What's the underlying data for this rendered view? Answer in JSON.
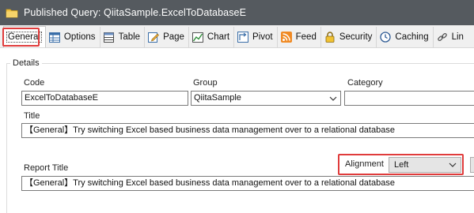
{
  "window": {
    "title": "Published Query: QiitaSample.ExcelToDatabaseE",
    "icon": "folder-icon"
  },
  "tabs": [
    {
      "label": "General",
      "icon": "none",
      "active": true
    },
    {
      "label": "Options",
      "icon": "options-grid-icon"
    },
    {
      "label": "Table",
      "icon": "table-icon"
    },
    {
      "label": "Page",
      "icon": "page-edit-icon"
    },
    {
      "label": "Chart",
      "icon": "chart-icon"
    },
    {
      "label": "Pivot",
      "icon": "pivot-icon"
    },
    {
      "label": "Feed",
      "icon": "rss-feed-icon"
    },
    {
      "label": "Security",
      "icon": "lock-icon"
    },
    {
      "label": "Caching",
      "icon": "clock-icon"
    },
    {
      "label": "Lin",
      "icon": "link-icon"
    }
  ],
  "details": {
    "legend": "Details",
    "code_label": "Code",
    "code_value": "ExcelToDatabaseE",
    "group_label": "Group",
    "group_value": "QiitaSample",
    "category_label": "Category",
    "category_value": "",
    "title_label": "Title",
    "title_value": "【General】Try switching Excel based business data management over to a relational database",
    "report_title_label": "Report Title",
    "report_title_value": "【General】Try switching Excel based business data management over to a relational database",
    "alignment_label": "Alignment",
    "alignment_value": "Left"
  },
  "colors": {
    "titlebar": "#555a5f",
    "highlight": "#e03c3c"
  }
}
